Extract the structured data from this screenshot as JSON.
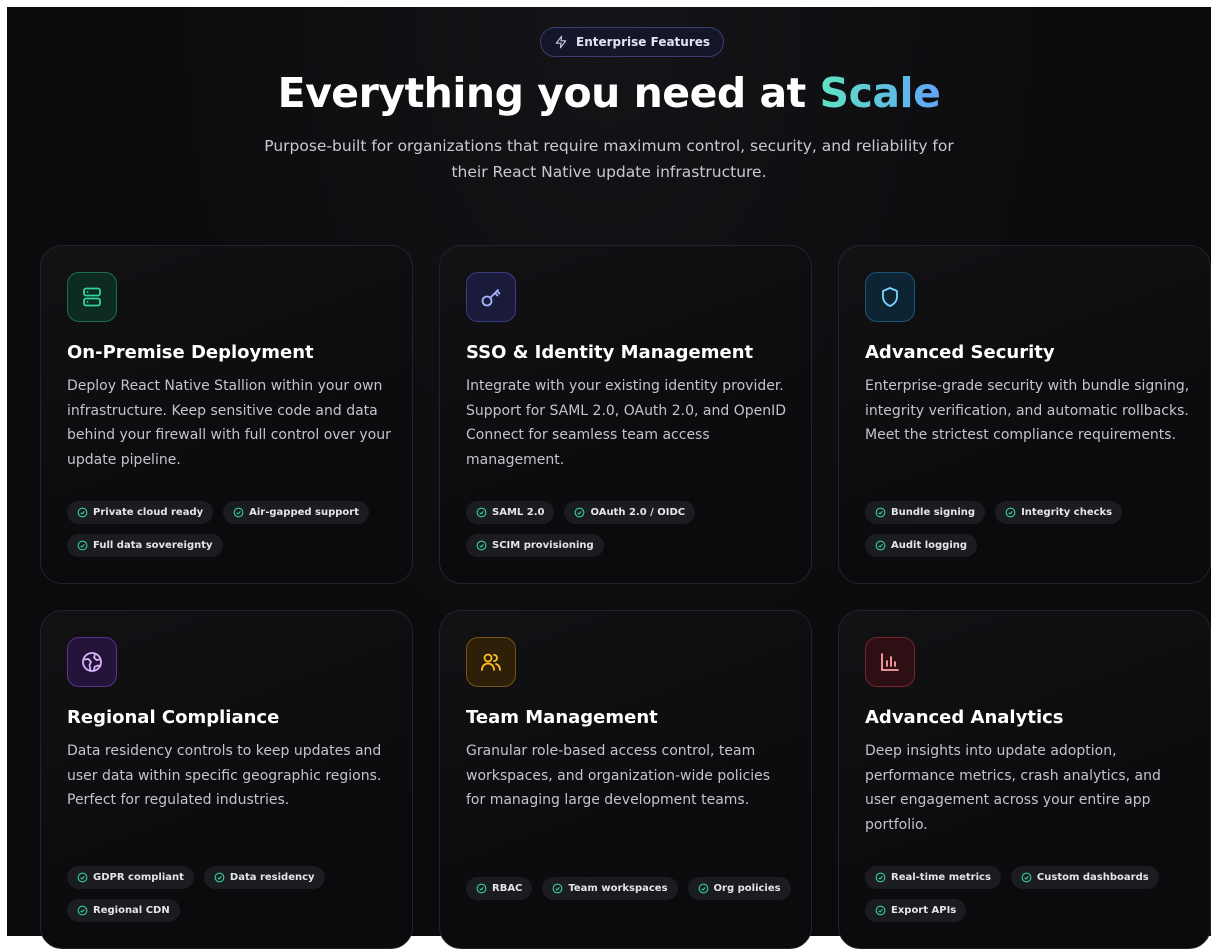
{
  "badge": {
    "icon": "zap-icon",
    "label": "Enterprise Features"
  },
  "hero": {
    "title_main": "Everything you need at ",
    "title_accent": "Scale",
    "subtitle": "Purpose-built for organizations that require maximum control, security, and reliability for their React Native update infrastructure."
  },
  "colors": {
    "accent_gradient_start": "#5fe3c0",
    "accent_gradient_end": "#60a5fa",
    "check_green": "#34d399"
  },
  "features": [
    {
      "icon": "server-icon",
      "color": "#34d399",
      "title": "On-Premise Deployment",
      "description": "Deploy React Native Stallion within your own infrastructure. Keep sensitive code and data behind your firewall with full control over your update pipeline.",
      "tags": [
        "Private cloud ready",
        "Air-gapped support",
        "Full data sovereignty"
      ]
    },
    {
      "icon": "key-icon",
      "color": "#818cf8",
      "title": "SSO & Identity Management",
      "description": "Integrate with your existing identity provider. Support for SAML 2.0, OAuth 2.0, and OpenID Connect for seamless team access management.",
      "tags": [
        "SAML 2.0",
        "OAuth 2.0 / OIDC",
        "SCIM provisioning"
      ]
    },
    {
      "icon": "shield-icon",
      "color": "#38bdf8",
      "title": "Advanced Security",
      "description": "Enterprise-grade security with bundle signing, integrity verification, and automatic rollbacks. Meet the strictest compliance requirements.",
      "tags": [
        "Bundle signing",
        "Integrity checks",
        "Audit logging"
      ]
    },
    {
      "icon": "globe-icon",
      "color": "#c084fc",
      "title": "Regional Compliance",
      "description": "Data residency controls to keep updates and user data within specific geographic regions. Perfect for regulated industries.",
      "tags": [
        "GDPR compliant",
        "Data residency",
        "Regional CDN"
      ]
    },
    {
      "icon": "users-icon",
      "color": "#fbbf24",
      "title": "Team Management",
      "description": "Granular role-based access control, team workspaces, and organization-wide policies for managing large development teams.",
      "tags": [
        "RBAC",
        "Team workspaces",
        "Org policies"
      ]
    },
    {
      "icon": "bar-chart-icon",
      "color": "#f87171",
      "title": "Advanced Analytics",
      "description": "Deep insights into update adoption, performance metrics, crash analytics, and user engagement across your entire app portfolio.",
      "tags": [
        "Real-time metrics",
        "Custom dashboards",
        "Export APIs"
      ]
    }
  ]
}
